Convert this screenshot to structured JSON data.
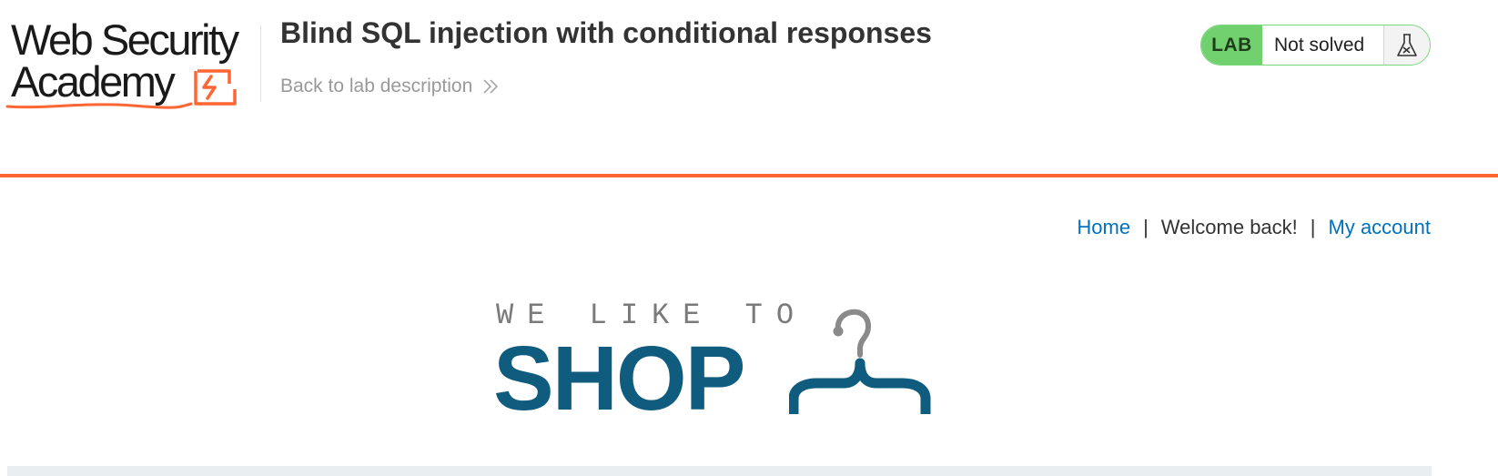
{
  "brand": {
    "line1": "Web Security",
    "line2": "Academy",
    "accent_color": "#ff6633"
  },
  "lab": {
    "title": "Blind SQL injection with conditional responses",
    "back_link": "Back to lab description",
    "badge_label": "LAB",
    "status": "Not solved",
    "status_icon": "flask-icon"
  },
  "nav": {
    "home": "Home",
    "separator": "|",
    "welcome": "Welcome back!",
    "account": "My account"
  },
  "shop_logo": {
    "tagline": "WE LIKE TO",
    "word": "SHOP",
    "icon": "hanger-icon"
  },
  "colors": {
    "header_rule": "#ff6633",
    "link": "#0071bc",
    "status_green": "#70d16e",
    "shop_blue": "#0f5c7e"
  }
}
